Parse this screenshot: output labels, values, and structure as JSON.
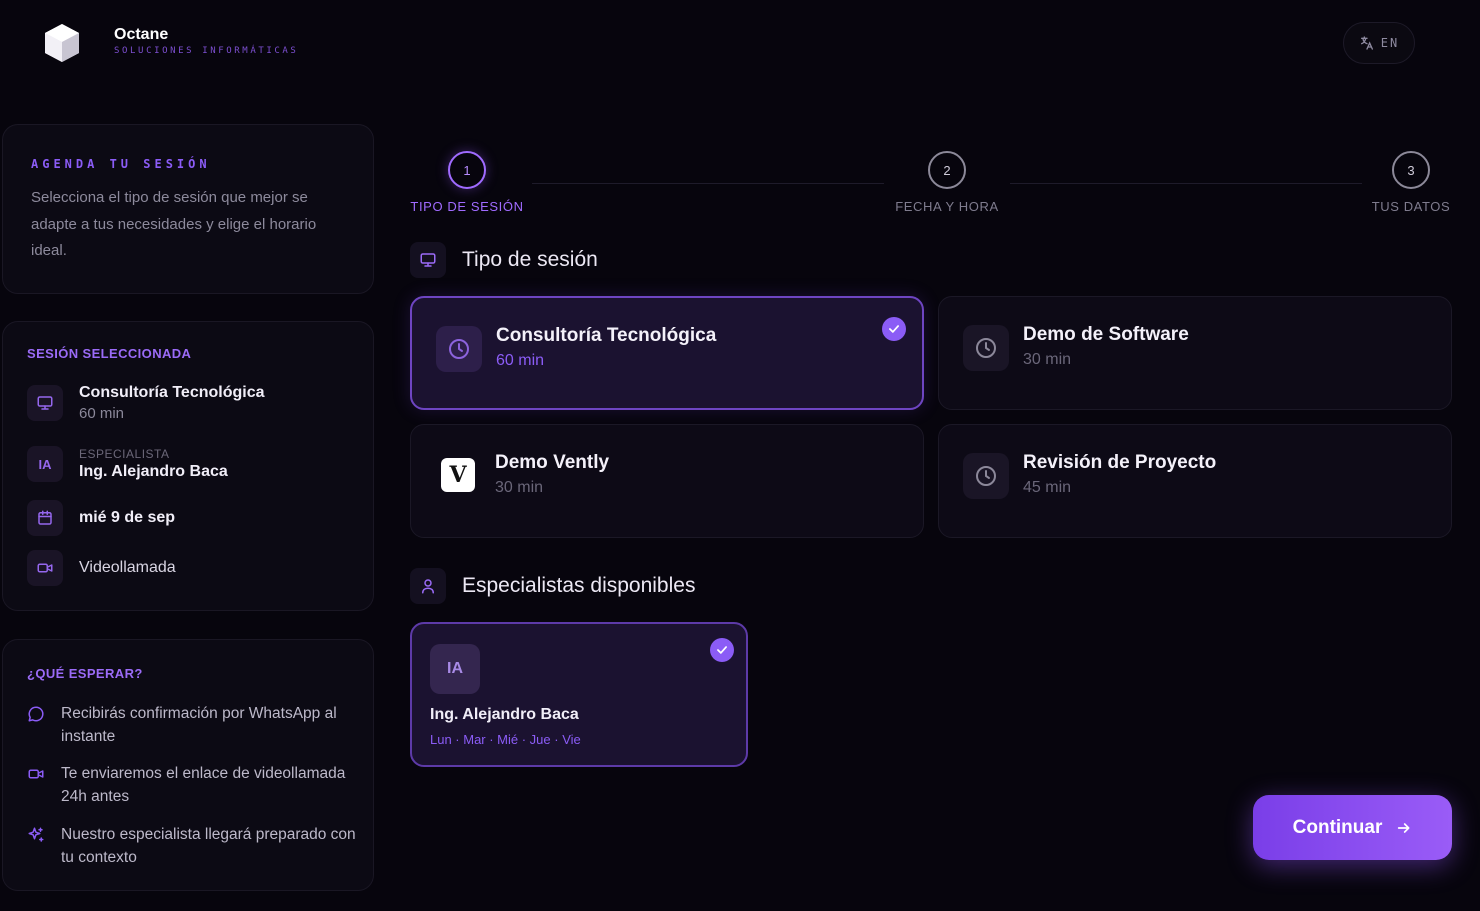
{
  "header": {
    "brand_name": "Octane",
    "brand_subtitle": "SOLUCIONES INFORMÁTICAS",
    "logo_icon": "hexagon-cube-logo",
    "language_label": "EN",
    "language_icon": "translate-icon"
  },
  "intro": {
    "title": "AGENDA TU SESIÓN",
    "text": "Selecciona el tipo de sesión que mejor se adapte a tus necesidades y elige el horario ideal."
  },
  "summary": {
    "heading": "SESIÓN SELECCIONADA",
    "session_name": "Consultoría Tecnológica",
    "session_duration": "60 min",
    "specialist_initials": "IA",
    "specialist_label": "ESPECIALISTA",
    "specialist_name": "Ing. Alejandro Baca",
    "date": "mié 9 de sep",
    "mode": "Videollamada"
  },
  "expect": {
    "heading": "¿QUÉ ESPERAR?",
    "items": [
      {
        "icon": "chat-bubble-icon",
        "text": "Recibirás confirmación por WhatsApp al instante"
      },
      {
        "icon": "video-camera-icon",
        "text": "Te enviaremos el enlace de videollamada 24h antes"
      },
      {
        "icon": "sparkles-icon",
        "text": "Nuestro especialista llegará preparado con tu contexto"
      }
    ]
  },
  "stepper": {
    "steps": [
      {
        "number": "1",
        "label": "TIPO DE SESIÓN",
        "active": true
      },
      {
        "number": "2",
        "label": "FECHA Y HORA",
        "active": false
      },
      {
        "number": "3",
        "label": "TUS DATOS",
        "active": false
      }
    ]
  },
  "session_types": {
    "title": "Tipo de sesión",
    "options": [
      {
        "name": "Consultoría Tecnológica",
        "duration": "60 min",
        "icon": "clock-icon",
        "selected": true
      },
      {
        "name": "Demo de Software",
        "duration": "30 min",
        "icon": "clock-icon",
        "selected": false
      },
      {
        "name": "Demo Vently",
        "duration": "30 min",
        "icon": "vently-logo",
        "logo_letter": "V",
        "selected": false
      },
      {
        "name": "Revisión de Proyecto",
        "duration": "45 min",
        "icon": "clock-icon",
        "selected": false
      }
    ]
  },
  "specialists": {
    "title": "Especialistas disponibles",
    "items": [
      {
        "initials": "IA",
        "name": "Ing. Alejandro Baca",
        "days": "Lun · Mar · Mié · Jue · Vie",
        "selected": true
      }
    ]
  },
  "actions": {
    "continue_label": "Continuar"
  },
  "colors": {
    "background": "#07050d",
    "accent": "#8b5cf6",
    "card": "#0c0a14",
    "selected_card": "#1b1230"
  }
}
